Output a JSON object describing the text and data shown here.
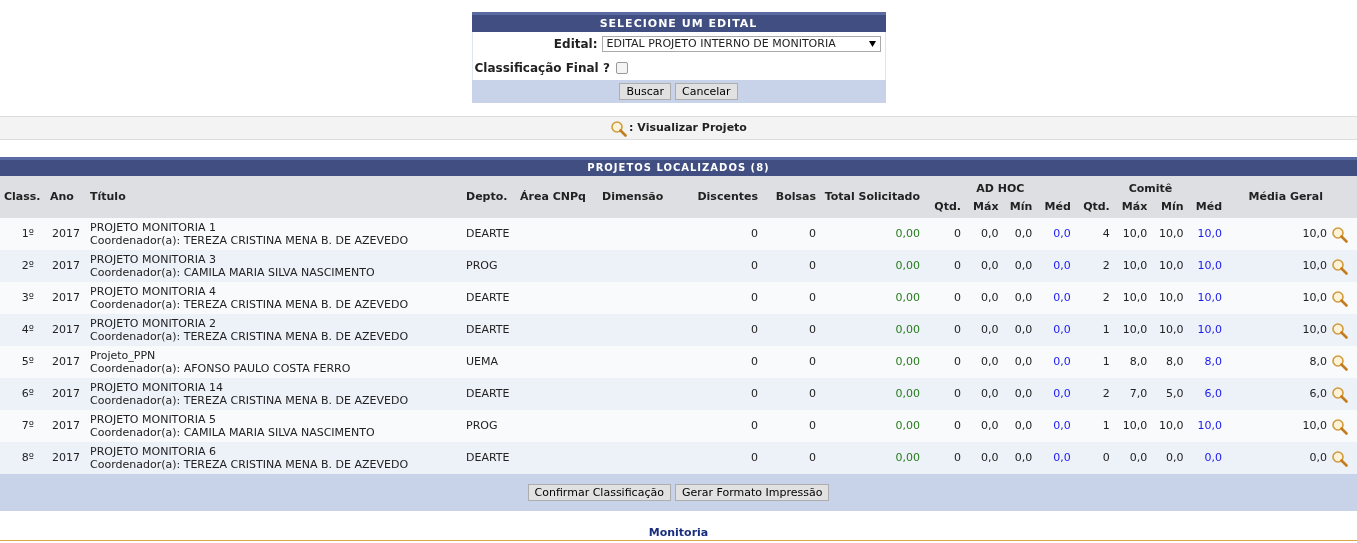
{
  "form": {
    "title": "SELECIONE UM EDITAL",
    "edital_label": "Edital:",
    "edital_value": "EDITAL PROJETO INTERNO DE MONITORIA",
    "final_label": "Classificação Final ?",
    "final_checked": false,
    "buttons": [
      "Buscar",
      "Cancelar"
    ]
  },
  "legend": {
    "text": ": Visualizar Projeto"
  },
  "table": {
    "title": "PROJETOS LOCALIZADOS (8)",
    "columns": [
      "Class.",
      "Ano",
      "Título",
      "Depto.",
      "Área CNPq",
      "Dimensão",
      "Discentes",
      "Bolsas",
      "Total Solicitado",
      "Média Geral"
    ],
    "groups": [
      {
        "label": "AD HOC",
        "columns": [
          "Qtd.",
          "Máx",
          "Mín",
          "Méd"
        ]
      },
      {
        "label": "Comitê",
        "columns": [
          "Qtd.",
          "Máx",
          "Mín",
          "Méd"
        ]
      }
    ],
    "rows": [
      {
        "class": "1º",
        "ano": "2017",
        "titulo": "PROJETO MONITORIA 1",
        "coordenador": "Coordenador(a): TEREZA CRISTINA MENA B. DE AZEVEDO",
        "depto": "DEARTE",
        "discentes": "0",
        "bolsas": "0",
        "total": "0,00",
        "adhoc": [
          "0",
          "0,0",
          "0,0",
          "0,0"
        ],
        "comite": [
          "4",
          "10,0",
          "10,0",
          "10,0"
        ],
        "media": "10,0"
      },
      {
        "class": "2º",
        "ano": "2017",
        "titulo": "PROJETO MONITORIA 3",
        "coordenador": "Coordenador(a): CAMILA MARIA SILVA NASCIMENTO",
        "depto": "PROG",
        "discentes": "0",
        "bolsas": "0",
        "total": "0,00",
        "adhoc": [
          "0",
          "0,0",
          "0,0",
          "0,0"
        ],
        "comite": [
          "2",
          "10,0",
          "10,0",
          "10,0"
        ],
        "media": "10,0"
      },
      {
        "class": "3º",
        "ano": "2017",
        "titulo": "PROJETO MONITORIA 4",
        "coordenador": "Coordenador(a): TEREZA CRISTINA MENA B. DE AZEVEDO",
        "depto": "DEARTE",
        "discentes": "0",
        "bolsas": "0",
        "total": "0,00",
        "adhoc": [
          "0",
          "0,0",
          "0,0",
          "0,0"
        ],
        "comite": [
          "2",
          "10,0",
          "10,0",
          "10,0"
        ],
        "media": "10,0"
      },
      {
        "class": "4º",
        "ano": "2017",
        "titulo": "PROJETO MONITORIA 2",
        "coordenador": "Coordenador(a): TEREZA CRISTINA MENA B. DE AZEVEDO",
        "depto": "DEARTE",
        "discentes": "0",
        "bolsas": "0",
        "total": "0,00",
        "adhoc": [
          "0",
          "0,0",
          "0,0",
          "0,0"
        ],
        "comite": [
          "1",
          "10,0",
          "10,0",
          "10,0"
        ],
        "media": "10,0"
      },
      {
        "class": "5º",
        "ano": "2017",
        "titulo": "Projeto_PPN",
        "coordenador": "Coordenador(a): AFONSO PAULO COSTA FERRO",
        "depto": "UEMA",
        "discentes": "0",
        "bolsas": "0",
        "total": "0,00",
        "adhoc": [
          "0",
          "0,0",
          "0,0",
          "0,0"
        ],
        "comite": [
          "1",
          "8,0",
          "8,0",
          "8,0"
        ],
        "media": "8,0"
      },
      {
        "class": "6º",
        "ano": "2017",
        "titulo": "PROJETO MONITORIA 14",
        "coordenador": "Coordenador(a): TEREZA CRISTINA MENA B. DE AZEVEDO",
        "depto": "DEARTE",
        "discentes": "0",
        "bolsas": "0",
        "total": "0,00",
        "adhoc": [
          "0",
          "0,0",
          "0,0",
          "0,0"
        ],
        "comite": [
          "2",
          "7,0",
          "5,0",
          "6,0"
        ],
        "media": "6,0"
      },
      {
        "class": "7º",
        "ano": "2017",
        "titulo": "PROJETO MONITORIA 5",
        "coordenador": "Coordenador(a): CAMILA MARIA SILVA NASCIMENTO",
        "depto": "PROG",
        "discentes": "0",
        "bolsas": "0",
        "total": "0,00",
        "adhoc": [
          "0",
          "0,0",
          "0,0",
          "0,0"
        ],
        "comite": [
          "1",
          "10,0",
          "10,0",
          "10,0"
        ],
        "media": "10,0"
      },
      {
        "class": "8º",
        "ano": "2017",
        "titulo": "PROJETO MONITORIA 6",
        "coordenador": "Coordenador(a): TEREZA CRISTINA MENA B. DE AZEVEDO",
        "depto": "DEARTE",
        "discentes": "0",
        "bolsas": "0",
        "total": "0,00",
        "adhoc": [
          "0",
          "0,0",
          "0,0",
          "0,0"
        ],
        "comite": [
          "0",
          "0,0",
          "0,0",
          "0,0"
        ],
        "media": "0,0"
      }
    ],
    "buttons": [
      "Confirmar Classificação",
      "Gerar Formato Impressão"
    ]
  },
  "footer": {
    "text": "Monitoria"
  }
}
